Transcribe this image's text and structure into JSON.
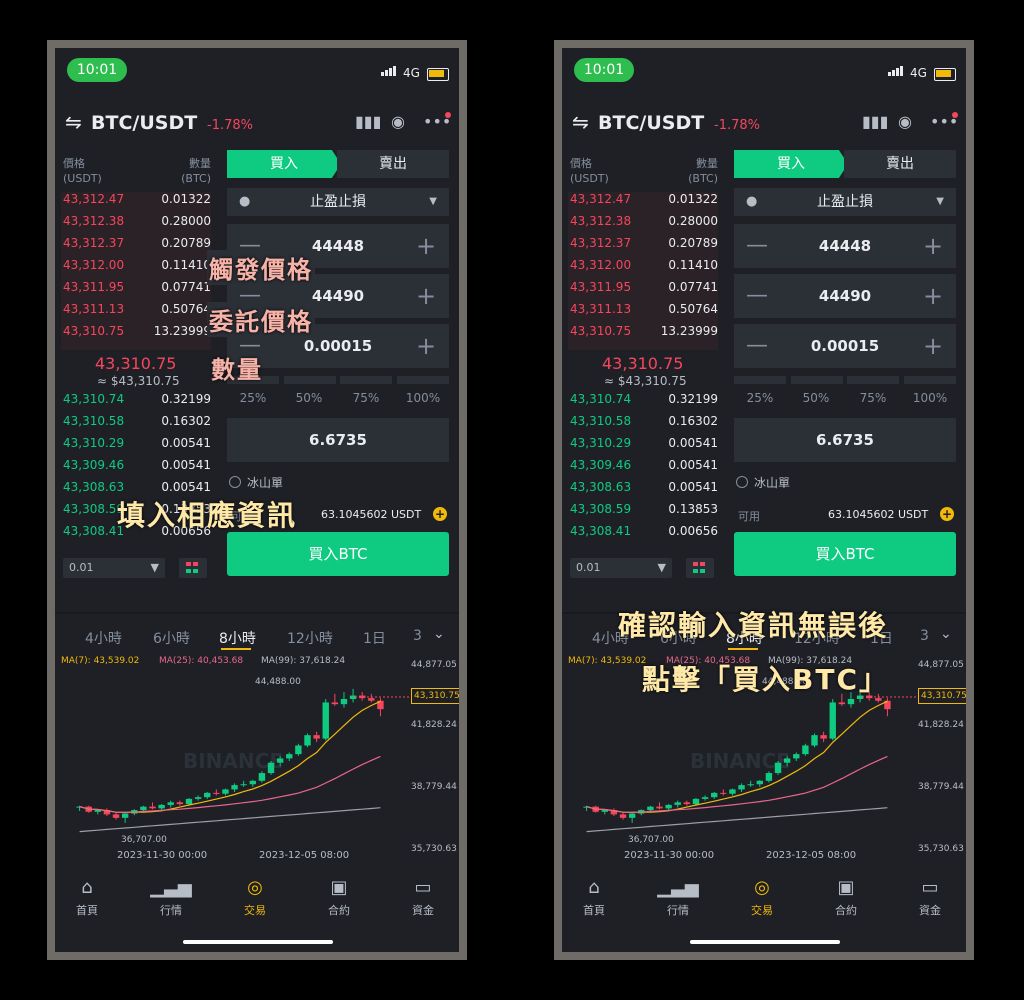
{
  "status": {
    "time": "10:01",
    "network": "4G"
  },
  "header": {
    "pair": "BTC/USDT",
    "change": "-1.78%"
  },
  "orderbook": {
    "price_label": "價格",
    "price_unit": "(USDT)",
    "qty_label": "數量",
    "qty_unit": "(BTC)",
    "asks": [
      {
        "price": "43,312.47",
        "qty": "0.01322"
      },
      {
        "price": "43,312.38",
        "qty": "0.28000"
      },
      {
        "price": "43,312.37",
        "qty": "0.20789"
      },
      {
        "price": "43,312.00",
        "qty": "0.11410"
      },
      {
        "price": "43,311.95",
        "qty": "0.07741"
      },
      {
        "price": "43,311.13",
        "qty": "0.50764"
      },
      {
        "price": "43,310.75",
        "qty": "13.23999"
      }
    ],
    "mid_price": "43,310.75",
    "mid_usd": "≈ $43,310.75",
    "bids": [
      {
        "price": "43,310.74",
        "qty": "0.32199"
      },
      {
        "price": "43,310.58",
        "qty": "0.16302"
      },
      {
        "price": "43,310.29",
        "qty": "0.00541"
      },
      {
        "price": "43,309.46",
        "qty": "0.00541"
      },
      {
        "price": "43,308.63",
        "qty": "0.00541"
      },
      {
        "price": "43,308.59",
        "qty": "0.13853"
      },
      {
        "price": "43,308.41",
        "qty": "0.00656"
      }
    ],
    "depth": "0.01"
  },
  "order": {
    "buy_tab": "買入",
    "sell_tab": "賣出",
    "order_type": "止盈止損",
    "trigger_price": "44448",
    "limit_price": "44490",
    "amount": "0.00015",
    "percents": [
      "25%",
      "50%",
      "75%",
      "100%"
    ],
    "total": "6.6735",
    "iceberg": "冰山單",
    "available_label": "可用",
    "available_value": "63.1045602 USDT",
    "buy_button": "買入BTC"
  },
  "timeframes": [
    "4小時",
    "6小時",
    "8小時",
    "12小時",
    "1日",
    "3"
  ],
  "active_timeframe": "8小時",
  "ma": {
    "ma7": "MA(7): 43,539.02",
    "ma25": "MA(25): 40,453.68",
    "ma99": "MA(99): 37,618.24"
  },
  "chart_labels": {
    "y_ticks": [
      "44,877.05",
      "41,828.24",
      "38,779.44",
      "35,730.63"
    ],
    "high": "44,488.00",
    "low": "36,707.00",
    "last": "43,310.75",
    "dates": [
      "2023-11-30 00:00",
      "2023-12-05 08:00"
    ],
    "watermark": "BINANCE"
  },
  "nav": [
    "首頁",
    "行情",
    "交易",
    "合約",
    "資金"
  ],
  "overlays": {
    "trigger": "觸發價格",
    "limit": "委託價格",
    "amount": "數量",
    "fill_info": "填入相應資訊",
    "confirm_line1": "確認輸入資訊無誤後",
    "confirm_line2": "點擊「買入BTC」"
  },
  "colors": {
    "buy": "#0ecb81",
    "sell": "#f6465d",
    "accent": "#f0b90b",
    "bg": "#1e2026",
    "frame": "#6f6c68"
  },
  "chart_data": {
    "type": "candlestick",
    "y_ticks": [
      44877.05,
      41828.24,
      38779.44,
      35730.63
    ],
    "ylim": [
      34900,
      45700
    ],
    "candles": [
      [
        37600,
        37700,
        37400,
        37650
      ],
      [
        37650,
        37700,
        37300,
        37350
      ],
      [
        37350,
        37500,
        37200,
        37450
      ],
      [
        37450,
        37550,
        37100,
        37200
      ],
      [
        37200,
        37300,
        36900,
        37000
      ],
      [
        37000,
        37300,
        36707,
        37250
      ],
      [
        37250,
        37500,
        37150,
        37450
      ],
      [
        37450,
        37700,
        37350,
        37650
      ],
      [
        37650,
        37900,
        37500,
        37550
      ],
      [
        37550,
        37800,
        37450,
        37750
      ],
      [
        37750,
        38000,
        37600,
        37900
      ],
      [
        37900,
        38000,
        37700,
        37800
      ],
      [
        37800,
        38150,
        37700,
        38100
      ],
      [
        38100,
        38300,
        38000,
        38200
      ],
      [
        38200,
        38500,
        38100,
        38450
      ],
      [
        38450,
        38650,
        38300,
        38400
      ],
      [
        38400,
        38700,
        38300,
        38650
      ],
      [
        38650,
        39000,
        38500,
        38900
      ],
      [
        38900,
        39150,
        38800,
        38950
      ],
      [
        38950,
        39200,
        38800,
        39150
      ],
      [
        39150,
        39700,
        39050,
        39600
      ],
      [
        39600,
        40300,
        39500,
        40200
      ],
      [
        40200,
        40600,
        40000,
        40450
      ],
      [
        40450,
        40800,
        40300,
        40700
      ],
      [
        40700,
        41300,
        40600,
        41200
      ],
      [
        41200,
        41900,
        41100,
        41800
      ],
      [
        41800,
        42000,
        41400,
        41600
      ],
      [
        41600,
        43900,
        41500,
        43700
      ],
      [
        43700,
        44200,
        43500,
        43600
      ],
      [
        43600,
        44300,
        43400,
        43900
      ],
      [
        43900,
        44488,
        43700,
        44100
      ],
      [
        44100,
        44300,
        43800,
        43950
      ],
      [
        43950,
        44200,
        43700,
        43800
      ],
      [
        43800,
        43950,
        42900,
        43310.75
      ]
    ]
  }
}
